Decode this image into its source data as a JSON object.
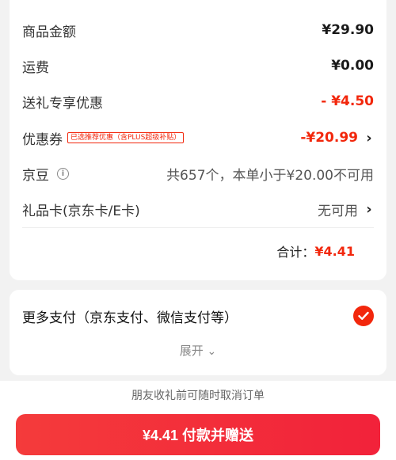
{
  "price_card": {
    "goods_amount": {
      "label": "商品金额",
      "value": "¥29.90"
    },
    "shipping": {
      "label": "运费",
      "value": "¥0.00"
    },
    "gift_discount": {
      "label": "送礼专享优惠",
      "value": "- ¥4.50"
    },
    "coupon": {
      "label": "优惠券",
      "tag": "已选推荐优惠（含PLUS超级补贴）",
      "value": "-¥20.99"
    },
    "jingdou": {
      "label": "京豆",
      "value": "共657个，本单小于¥20.00不可用"
    },
    "gift_card": {
      "label": "礼品卡(京东卡/E卡)",
      "value": "无可用"
    },
    "total": {
      "label": "合计：",
      "value": "¥4.41"
    }
  },
  "payment": {
    "label": "更多支付（京东支付、微信支付等）",
    "selected": true,
    "expand_label": "展开",
    "expand_icon": "⌄"
  },
  "notice": "朋友收礼前可随时取消订单",
  "pay_button": "¥4.41 付款并赠送",
  "colors": {
    "accent": "#f2270c",
    "button": "#f43b3b"
  }
}
